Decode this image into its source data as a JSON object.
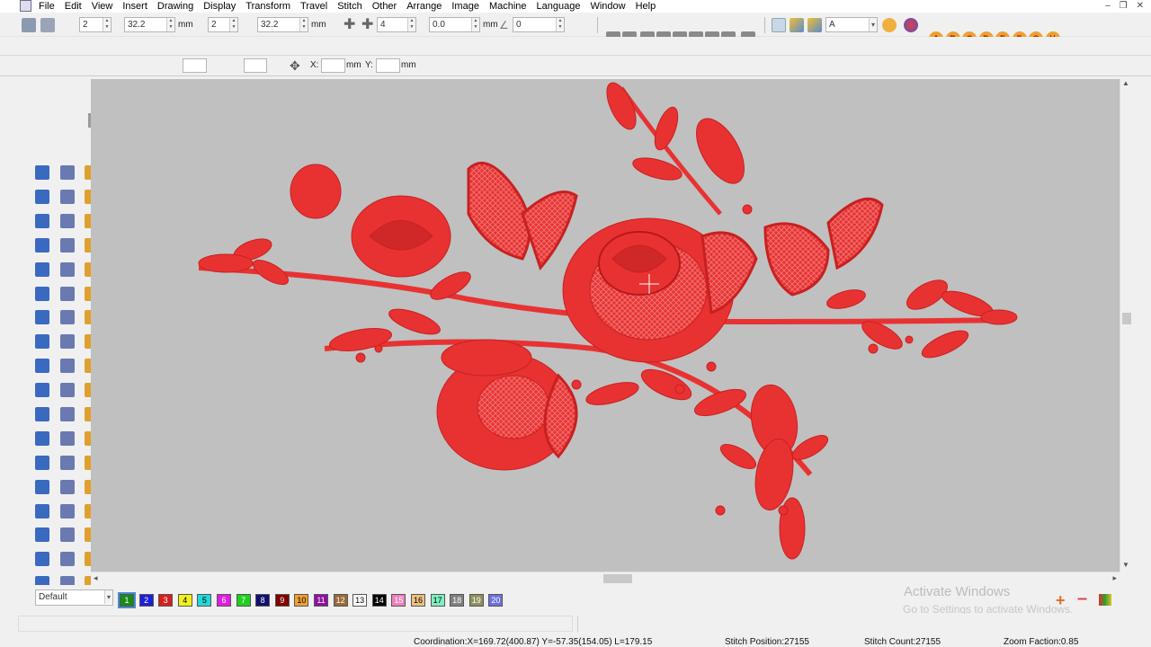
{
  "menubar": {
    "items": [
      "File",
      "Edit",
      "View",
      "Insert",
      "Drawing",
      "Display",
      "Transform",
      "Travel",
      "Stitch",
      "Other",
      "Arrange",
      "Image",
      "Machine",
      "Language",
      "Window",
      "Help"
    ]
  },
  "toolbar1": {
    "field1": "2",
    "field2": "32.2",
    "unit_mm1": "mm",
    "field3": "2",
    "field4": "32.2",
    "unit_mm2": "mm",
    "field5": "4",
    "field6": "0.0",
    "unit_mm3": "mm",
    "field7": "0",
    "font_select": "A"
  },
  "toolbar3": {
    "x_label": "X:",
    "x_unit": "mm",
    "y_label": "Y:",
    "y_unit": "mm"
  },
  "palette": {
    "layer_select": "Default",
    "swatches": [
      {
        "n": "1",
        "color": "#1a8a1a"
      },
      {
        "n": "2",
        "color": "#1f1fd6"
      },
      {
        "n": "3",
        "color": "#d62020"
      },
      {
        "n": "4",
        "color": "#f2f21a"
      },
      {
        "n": "5",
        "color": "#22d8d8"
      },
      {
        "n": "6",
        "color": "#e01ee0"
      },
      {
        "n": "7",
        "color": "#1ed01e"
      },
      {
        "n": "8",
        "color": "#101070"
      },
      {
        "n": "9",
        "color": "#800000"
      },
      {
        "n": "10",
        "color": "#f0a030"
      },
      {
        "n": "11",
        "color": "#9010a0"
      },
      {
        "n": "12",
        "color": "#9a6a3a"
      },
      {
        "n": "13",
        "color": "#ffffff"
      },
      {
        "n": "14",
        "color": "#000000"
      },
      {
        "n": "15",
        "color": "#f080c0"
      },
      {
        "n": "16",
        "color": "#f0c080"
      },
      {
        "n": "17",
        "color": "#80f0c0"
      },
      {
        "n": "18",
        "color": "#808080"
      },
      {
        "n": "19",
        "color": "#909060"
      },
      {
        "n": "20",
        "color": "#7070e0"
      }
    ]
  },
  "watermark": {
    "line1": "Activate Windows",
    "line2": "Go to Settings to activate Windows."
  },
  "status": {
    "coordination": "Coordination:X=169.72(400.87) Y=-57.35(154.05) L=179.15",
    "stitch_position": "Stitch Position:27155",
    "stitch_count": "Stitch Count:27155",
    "zoom": "Zoom Faction:0.85"
  },
  "colors": {
    "embroidery_red": "#e83232",
    "canvas_gray": "#c0c0c0"
  }
}
